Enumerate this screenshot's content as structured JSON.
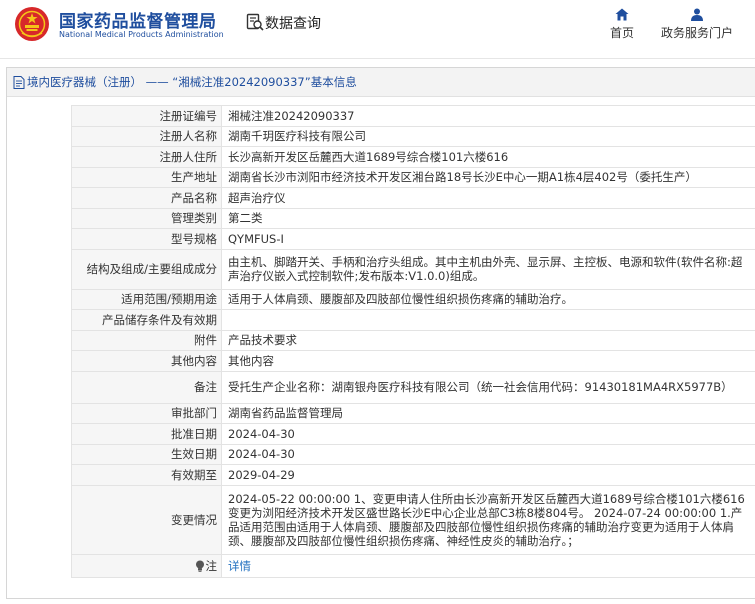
{
  "header": {
    "site_name": "国家药品监督管理局",
    "site_name_en": "National Medical Products Administration",
    "query_title": "数据查询",
    "nav": {
      "home": "首页",
      "portal": "政务服务门户"
    }
  },
  "panel": {
    "title": "境内医疗器械（注册） —— “湘械注准20242090337”基本信息"
  },
  "fields": [
    {
      "label": "注册证编号",
      "value": "湘械注准20242090337"
    },
    {
      "label": "注册人名称",
      "value": "湖南千玥医疗科技有限公司"
    },
    {
      "label": "注册人住所",
      "value": "长沙高新开发区岳麓西大道1689号综合楼101六楼616"
    },
    {
      "label": "生产地址",
      "value": "湖南省长沙市浏阳市经济技术开发区湘台路18号长沙E中心一期A1栋4层402号（委托生产）"
    },
    {
      "label": "产品名称",
      "value": "超声治疗仪"
    },
    {
      "label": "管理类别",
      "value": "第二类"
    },
    {
      "label": "型号规格",
      "value": "QYMFUS-I"
    },
    {
      "label": "结构及组成/主要组成成分",
      "value": "由主机、脚踏开关、手柄和治疗头组成。其中主机由外壳、显示屏、主控板、电源和软件(软件名称:超声治疗仪嵌入式控制软件;发布版本:V1.0.0)组成。"
    },
    {
      "label": "适用范围/预期用途",
      "value": "适用于人体肩颈、腰腹部及四肢部位慢性组织损伤疼痛的辅助治疗。"
    },
    {
      "label": "产品储存条件及有效期",
      "value": ""
    },
    {
      "label": "附件",
      "value": "产品技术要求"
    },
    {
      "label": "其他内容",
      "value": "其他内容"
    },
    {
      "label": "备注",
      "value": "受托生产企业名称：湖南银舟医疗科技有限公司（统一社会信用代码：91430181MA4RX5977B）"
    },
    {
      "label": "审批部门",
      "value": "湖南省药品监督管理局"
    },
    {
      "label": "批准日期",
      "value": "2024-04-30"
    },
    {
      "label": "生效日期",
      "value": "2024-04-30"
    },
    {
      "label": "有效期至",
      "value": "2029-04-29"
    },
    {
      "label": "变更情况",
      "value": "2024-05-22 00:00:00 1、变更申请人住所由长沙高新开发区岳麓西大道1689号综合楼101六楼616变更为浏阳经济技术开发区盛世路长沙E中心企业总部C3栋8楼804号。 2024-07-24 00:00:00 1.产品适用范围由适用于人体肩颈、腰腹部及四肢部位慢性组织损伤疼痛的辅助治疗变更为适用于人体肩颈、腰腹部及四肢部位慢性组织损伤疼痛、神经性皮炎的辅助治疗。；"
    }
  ],
  "note": {
    "label": "注",
    "link": "详情"
  },
  "colors": {
    "brand_blue": "#1f4e9e",
    "emblem_red": "#d7282a",
    "link_blue": "#1f6fbf"
  }
}
